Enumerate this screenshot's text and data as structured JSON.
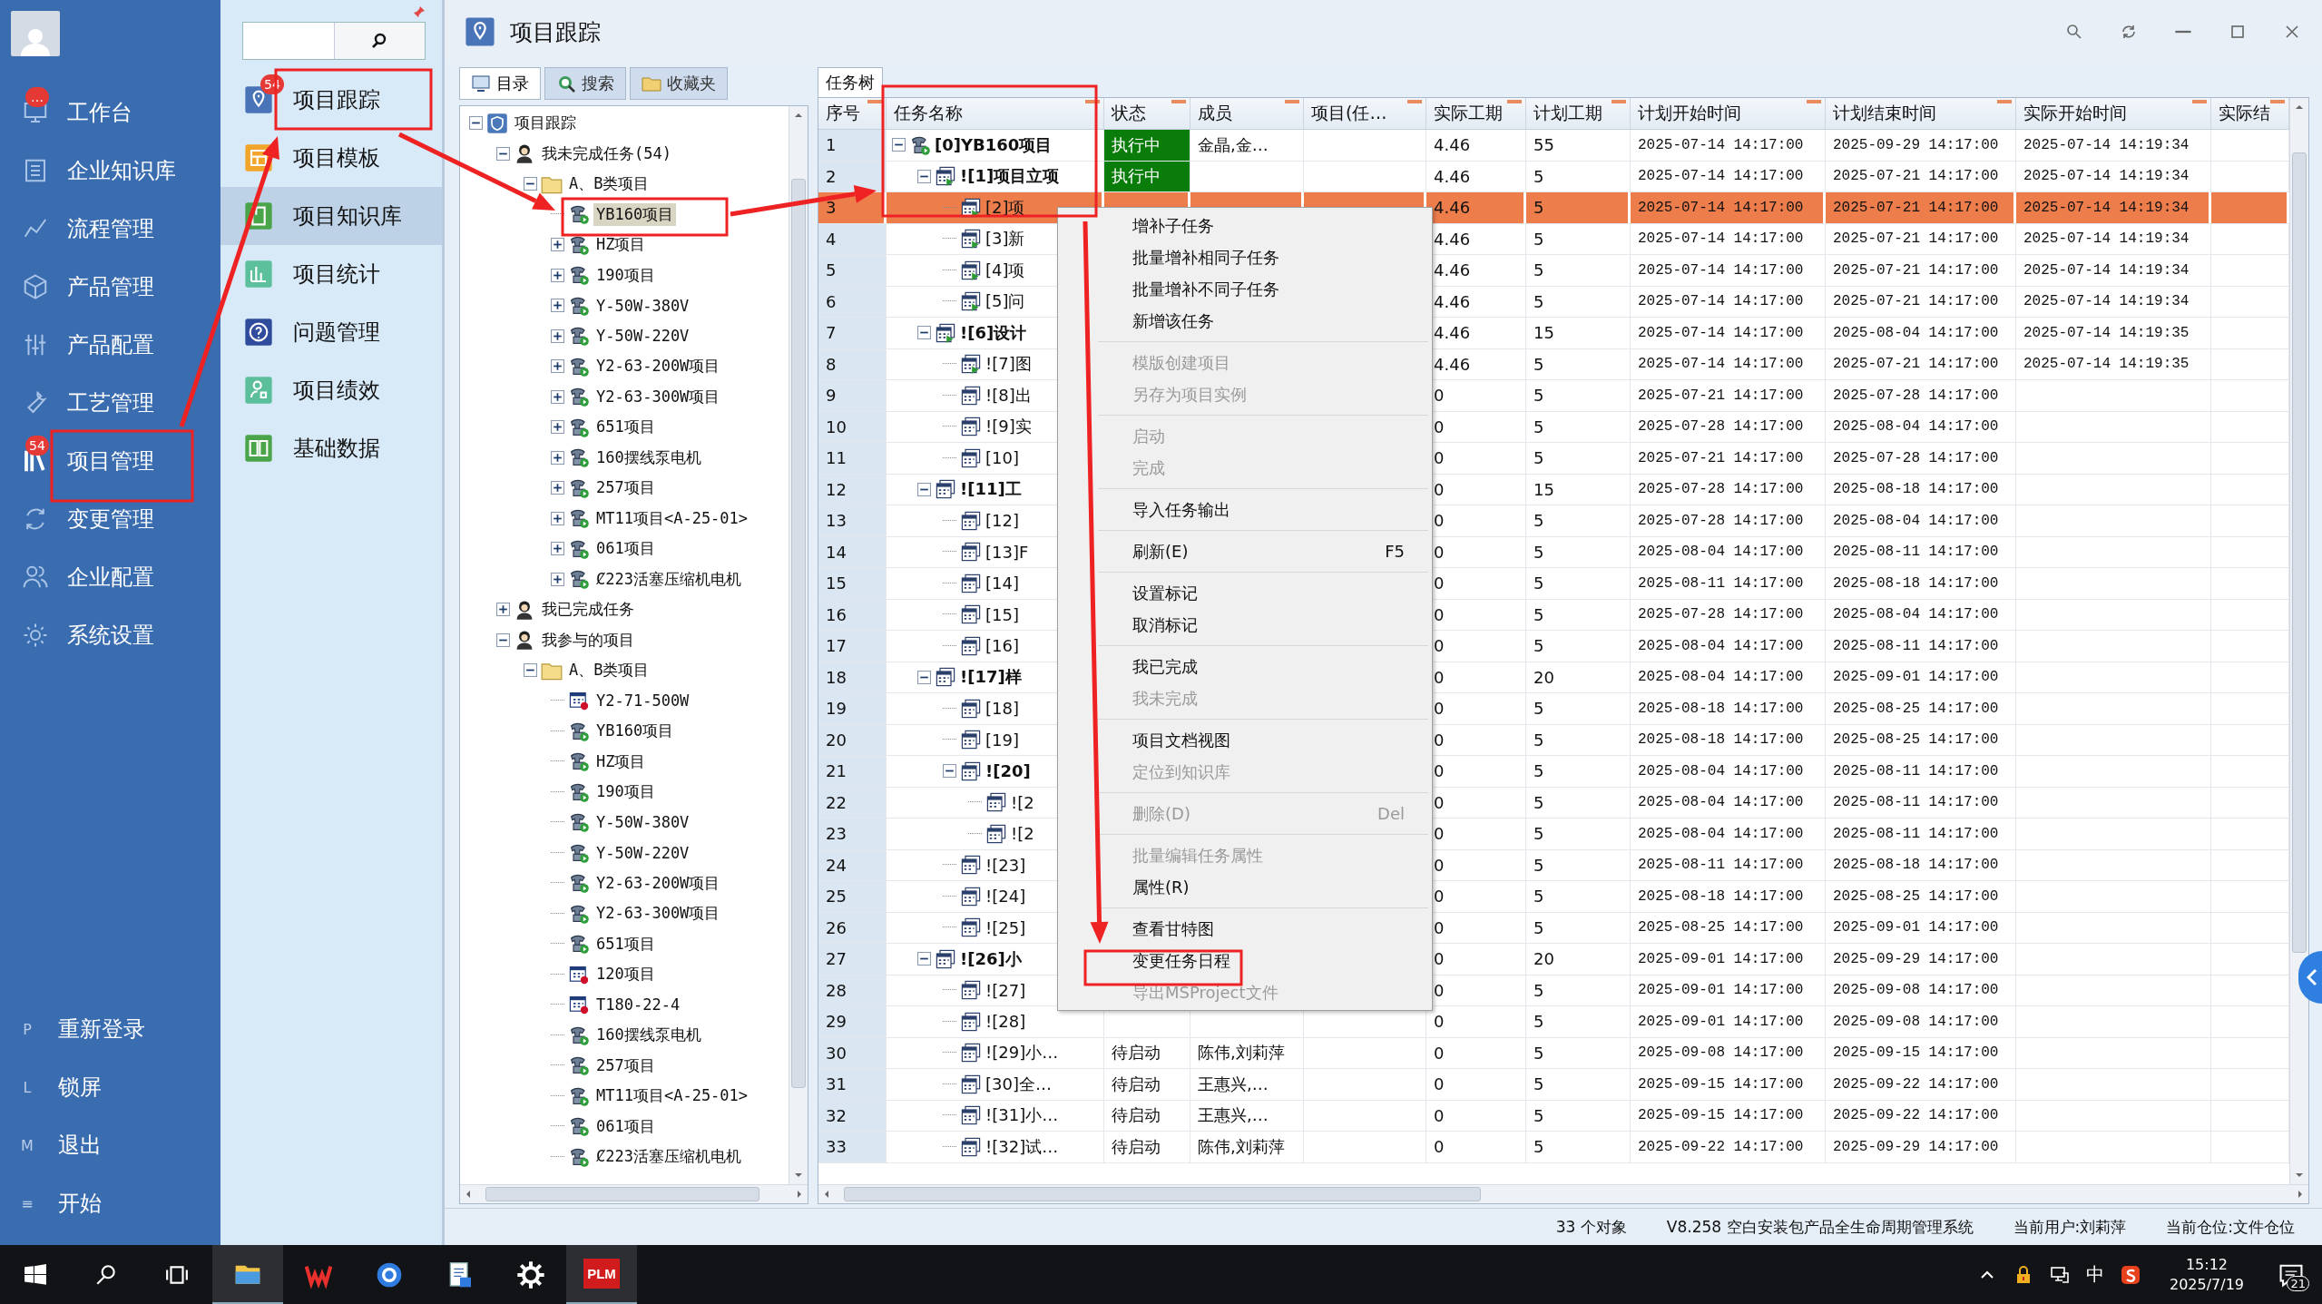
{
  "sidebar": {
    "nav": [
      {
        "label": "工作台",
        "badge": "…"
      },
      {
        "label": "企业知识库"
      },
      {
        "label": "流程管理"
      },
      {
        "label": "产品管理"
      },
      {
        "label": "产品配置"
      },
      {
        "label": "工艺管理"
      },
      {
        "label": "项目管理",
        "badge": "54"
      },
      {
        "label": "变更管理"
      },
      {
        "label": "企业配置"
      },
      {
        "label": "系统设置"
      }
    ],
    "bottom": [
      {
        "key": "P",
        "label": "重新登录"
      },
      {
        "key": "L",
        "label": "锁屏"
      },
      {
        "key": "M",
        "label": "退出"
      },
      {
        "key": "≡",
        "label": "开始"
      }
    ]
  },
  "subnav": {
    "items": [
      {
        "label": "项目跟踪",
        "badge": "54",
        "selected": false
      },
      {
        "label": "项目模板",
        "selected": false
      },
      {
        "label": "项目知识库",
        "selected": true
      },
      {
        "label": "项目统计",
        "selected": false
      },
      {
        "label": "问题管理",
        "selected": false
      },
      {
        "label": "项目绩效",
        "selected": false
      },
      {
        "label": "基础数据",
        "selected": false
      }
    ]
  },
  "window": {
    "title": "项目跟踪"
  },
  "pane_tabs": [
    {
      "label": "目录",
      "selected": true
    },
    {
      "label": "搜索",
      "selected": false
    },
    {
      "label": "收藏夹",
      "selected": false
    }
  ],
  "tree": [
    {
      "label": "项目跟踪",
      "kind": "root",
      "expanded": true,
      "selected": false,
      "children": [
        {
          "label": "我未完成任务(54)",
          "kind": "user",
          "expanded": true,
          "selected": false,
          "children": [
            {
              "label": "A、B类项目",
              "kind": "folder",
              "expanded": true,
              "selected": false,
              "children": [
                {
                  "label": "YB160项目",
                  "kind": "project",
                  "selected": true
                },
                {
                  "label": "HZ项目",
                  "kind": "project",
                  "expanded": false,
                  "selected": false
                },
                {
                  "label": "190项目",
                  "kind": "project",
                  "expanded": false,
                  "selected": false
                },
                {
                  "label": "Y-50W-380V",
                  "kind": "project",
                  "expanded": false,
                  "selected": false
                },
                {
                  "label": "Y-50W-220V",
                  "kind": "project",
                  "expanded": false,
                  "selected": false
                },
                {
                  "label": "Y2-63-200W项目",
                  "kind": "project",
                  "expanded": false,
                  "selected": false
                },
                {
                  "label": "Y2-63-300W项目",
                  "kind": "project",
                  "expanded": false,
                  "selected": false
                },
                {
                  "label": "651项目",
                  "kind": "project",
                  "expanded": false,
                  "selected": false
                },
                {
                  "label": "160摆线泵电机",
                  "kind": "project",
                  "expanded": false,
                  "selected": false
                },
                {
                  "label": "257项目",
                  "kind": "project",
                  "expanded": false,
                  "selected": false
                },
                {
                  "label": "MT11项目<A-25-01>",
                  "kind": "project",
                  "expanded": false,
                  "selected": false
                },
                {
                  "label": "061项目",
                  "kind": "project",
                  "expanded": false,
                  "selected": false
                },
                {
                  "label": "Ȼ223活塞压缩机电机",
                  "kind": "project",
                  "expanded": false,
                  "selected": false
                }
              ]
            }
          ]
        },
        {
          "label": "我已完成任务",
          "kind": "user",
          "expanded": false,
          "selected": false
        },
        {
          "label": "我参与的项目",
          "kind": "user",
          "expanded": true,
          "selected": false,
          "children": [
            {
              "label": "A、B类项目",
              "kind": "folder",
              "expanded": true,
              "selected": false,
              "children": [
                {
                  "label": "Y2-71-500W",
                  "kind": "plan",
                  "selected": false
                },
                {
                  "label": "YB160项目",
                  "kind": "project",
                  "selected": false
                },
                {
                  "label": "HZ项目",
                  "kind": "project",
                  "selected": false
                },
                {
                  "label": "190项目",
                  "kind": "project",
                  "selected": false
                },
                {
                  "label": "Y-50W-380V",
                  "kind": "project",
                  "selected": false
                },
                {
                  "label": "Y-50W-220V",
                  "kind": "project",
                  "selected": false
                },
                {
                  "label": "Y2-63-200W项目",
                  "kind": "project",
                  "selected": false
                },
                {
                  "label": "Y2-63-300W项目",
                  "kind": "project",
                  "selected": false
                },
                {
                  "label": "651项目",
                  "kind": "project",
                  "selected": false
                },
                {
                  "label": "120项目",
                  "kind": "plan",
                  "selected": false
                },
                {
                  "label": "T180-22-4",
                  "kind": "plan",
                  "selected": false
                },
                {
                  "label": "160摆线泵电机",
                  "kind": "project",
                  "selected": false
                },
                {
                  "label": "257项目",
                  "kind": "project",
                  "selected": false
                },
                {
                  "label": "MT11项目<A-25-01>",
                  "kind": "project",
                  "selected": false
                },
                {
                  "label": "061项目",
                  "kind": "project",
                  "selected": false
                },
                {
                  "label": "Ȼ223活塞压缩机电机",
                  "kind": "project",
                  "selected": false
                }
              ]
            }
          ]
        }
      ]
    }
  ],
  "grid": {
    "tab": "任务树",
    "columns": [
      "序号",
      "任务名称",
      "状态",
      "成员",
      "项目(任…",
      "实际工期",
      "计划工期",
      "计划开始时间",
      "计划结束时间",
      "实际开始时间",
      "实际结"
    ],
    "rows": [
      {
        "seq": "1",
        "name": "[0]YB160项目",
        "status": "执行中",
        "color": "#0a7c0a",
        "members": "金晶,金…",
        "actual_days": "4.46",
        "plan_days": "55",
        "plan_start": "2025-07-14 14:17:00",
        "plan_end": "2025-09-29 14:17:00",
        "actual_start": "2025-07-14 14:19:34",
        "started": true,
        "expanded": true,
        "selected": false,
        "children": [
          {
            "seq": "2",
            "name": "![1]项目立项",
            "status": "执行中",
            "color": "#0a7c0a",
            "actual_days": "4.46",
            "plan_days": "5",
            "plan_start": "2025-07-14 14:17:00",
            "plan_end": "2025-07-21 14:17:00",
            "actual_start": "2025-07-14 14:19:34",
            "started": true,
            "expanded": true,
            "selected": false,
            "children": [
              {
                "seq": "3",
                "name": "[2]项",
                "actual_days": "4.46",
                "plan_days": "5",
                "plan_start": "2025-07-14 14:17:00",
                "plan_end": "2025-07-21 14:17:00",
                "actual_start": "2025-07-14 14:19:34",
                "started": true,
                "selected": true
              },
              {
                "seq": "4",
                "name": "[3]新",
                "actual_days": "4.46",
                "plan_days": "5",
                "plan_start": "2025-07-14 14:17:00",
                "plan_end": "2025-07-21 14:17:00",
                "actual_start": "2025-07-14 14:19:34",
                "started": true,
                "selected": false
              },
              {
                "seq": "5",
                "name": "[4]项",
                "actual_days": "4.46",
                "plan_days": "5",
                "plan_start": "2025-07-14 14:17:00",
                "plan_end": "2025-07-21 14:17:00",
                "actual_start": "2025-07-14 14:19:34",
                "started": true,
                "selected": false
              },
              {
                "seq": "6",
                "name": "[5]问",
                "actual_days": "4.46",
                "plan_days": "5",
                "plan_start": "2025-07-14 14:17:00",
                "plan_end": "2025-07-21 14:17:00",
                "actual_start": "2025-07-14 14:19:34",
                "started": true,
                "selected": false
              }
            ]
          },
          {
            "seq": "7",
            "name": "![6]设计",
            "actual_days": "4.46",
            "plan_days": "15",
            "plan_start": "2025-07-14 14:17:00",
            "plan_end": "2025-08-04 14:17:00",
            "actual_start": "2025-07-14 14:19:35",
            "started": true,
            "expanded": true,
            "selected": false,
            "children": [
              {
                "seq": "8",
                "name": "![7]图",
                "actual_days": "4.46",
                "plan_days": "5",
                "plan_start": "2025-07-14 14:17:00",
                "plan_end": "2025-07-21 14:17:00",
                "actual_start": "2025-07-14 14:19:35",
                "started": true,
                "selected": false
              },
              {
                "seq": "9",
                "name": "![8]出",
                "actual_days": "0",
                "plan_days": "5",
                "plan_start": "2025-07-21 14:17:00",
                "plan_end": "2025-07-28 14:17:00",
                "started": false,
                "selected": false
              },
              {
                "seq": "10",
                "name": "![9]实",
                "actual_days": "0",
                "plan_days": "5",
                "plan_start": "2025-07-28 14:17:00",
                "plan_end": "2025-08-04 14:17:00",
                "started": false,
                "selected": false
              },
              {
                "seq": "11",
                "name": "[10]",
                "actual_days": "0",
                "plan_days": "5",
                "plan_start": "2025-07-21 14:17:00",
                "plan_end": "2025-07-28 14:17:00",
                "started": false,
                "selected": false
              }
            ]
          },
          {
            "seq": "12",
            "name": "![11]工",
            "actual_days": "0",
            "plan_days": "15",
            "plan_start": "2025-07-28 14:17:00",
            "plan_end": "2025-08-18 14:17:00",
            "started": false,
            "expanded": true,
            "selected": false,
            "children": [
              {
                "seq": "13",
                "name": "[12]",
                "actual_days": "0",
                "plan_days": "5",
                "plan_start": "2025-07-28 14:17:00",
                "plan_end": "2025-08-04 14:17:00",
                "started": false,
                "selected": false
              },
              {
                "seq": "14",
                "name": "[13]F",
                "actual_days": "0",
                "plan_days": "5",
                "plan_start": "2025-08-04 14:17:00",
                "plan_end": "2025-08-11 14:17:00",
                "started": false,
                "selected": false
              },
              {
                "seq": "15",
                "name": "[14]",
                "actual_days": "0",
                "plan_days": "5",
                "plan_start": "2025-08-11 14:17:00",
                "plan_end": "2025-08-18 14:17:00",
                "started": false,
                "selected": false
              },
              {
                "seq": "16",
                "name": "[15]",
                "actual_days": "0",
                "plan_days": "5",
                "plan_start": "2025-07-28 14:17:00",
                "plan_end": "2025-08-04 14:17:00",
                "started": false,
                "selected": false
              },
              {
                "seq": "17",
                "name": "[16]",
                "actual_days": "0",
                "plan_days": "5",
                "plan_start": "2025-08-04 14:17:00",
                "plan_end": "2025-08-11 14:17:00",
                "started": false,
                "selected": false
              }
            ]
          },
          {
            "seq": "18",
            "name": "![17]样",
            "actual_days": "0",
            "plan_days": "20",
            "plan_start": "2025-08-04 14:17:00",
            "plan_end": "2025-09-01 14:17:00",
            "started": false,
            "expanded": true,
            "selected": false,
            "children": [
              {
                "seq": "19",
                "name": "[18]",
                "actual_days": "0",
                "plan_days": "5",
                "plan_start": "2025-08-18 14:17:00",
                "plan_end": "2025-08-25 14:17:00",
                "started": false,
                "selected": false
              },
              {
                "seq": "20",
                "name": "[19]",
                "actual_days": "0",
                "plan_days": "5",
                "plan_start": "2025-08-18 14:17:00",
                "plan_end": "2025-08-25 14:17:00",
                "started": false,
                "selected": false
              },
              {
                "seq": "21",
                "name": "![20]",
                "actual_days": "0",
                "plan_days": "5",
                "plan_start": "2025-08-04 14:17:00",
                "plan_end": "2025-08-11 14:17:00",
                "started": false,
                "expanded": true,
                "selected": false,
                "children": [
                  {
                    "seq": "22",
                    "name": "![2",
                    "actual_days": "0",
                    "plan_days": "5",
                    "plan_start": "2025-08-04 14:17:00",
                    "plan_end": "2025-08-11 14:17:00",
                    "started": false,
                    "selected": false
                  },
                  {
                    "seq": "23",
                    "name": "![2",
                    "actual_days": "0",
                    "plan_days": "5",
                    "plan_start": "2025-08-04 14:17:00",
                    "plan_end": "2025-08-11 14:17:00",
                    "started": false,
                    "selected": false
                  }
                ]
              },
              {
                "seq": "24",
                "name": "![23]",
                "actual_days": "0",
                "plan_days": "5",
                "plan_start": "2025-08-11 14:17:00",
                "plan_end": "2025-08-18 14:17:00",
                "started": false,
                "selected": false
              },
              {
                "seq": "25",
                "name": "![24]",
                "actual_days": "0",
                "plan_days": "5",
                "plan_start": "2025-08-18 14:17:00",
                "plan_end": "2025-08-25 14:17:00",
                "started": false,
                "selected": false
              },
              {
                "seq": "26",
                "name": "![25]",
                "actual_days": "0",
                "plan_days": "5",
                "plan_start": "2025-08-25 14:17:00",
                "plan_end": "2025-09-01 14:17:00",
                "started": false,
                "selected": false
              }
            ]
          },
          {
            "seq": "27",
            "name": "![26]小",
            "actual_days": "0",
            "plan_days": "20",
            "plan_start": "2025-09-01 14:17:00",
            "plan_end": "2025-09-29 14:17:00",
            "started": false,
            "expanded": true,
            "selected": false,
            "children": [
              {
                "seq": "28",
                "name": "![27]",
                "actual_days": "0",
                "plan_days": "5",
                "plan_start": "2025-09-01 14:17:00",
                "plan_end": "2025-09-08 14:17:00",
                "started": false,
                "selected": false
              },
              {
                "seq": "29",
                "name": "![28]",
                "actual_days": "0",
                "plan_days": "5",
                "plan_start": "2025-09-01 14:17:00",
                "plan_end": "2025-09-08 14:17:00",
                "started": false,
                "selected": false
              },
              {
                "seq": "30",
                "name": "![29]小…",
                "status": "待启动",
                "members": "陈伟,刘莉萍",
                "actual_days": "0",
                "plan_days": "5",
                "plan_start": "2025-09-08 14:17:00",
                "plan_end": "2025-09-15 14:17:00",
                "started": false,
                "selected": false
              },
              {
                "seq": "31",
                "name": "[30]全…",
                "status": "待启动",
                "members": "王惠兴,…",
                "actual_days": "0",
                "plan_days": "5",
                "plan_start": "2025-09-15 14:17:00",
                "plan_end": "2025-09-22 14:17:00",
                "started": false,
                "selected": false
              },
              {
                "seq": "32",
                "name": "![31]小…",
                "status": "待启动",
                "members": "王惠兴,…",
                "actual_days": "0",
                "plan_days": "5",
                "plan_start": "2025-09-15 14:17:00",
                "plan_end": "2025-09-22 14:17:00",
                "started": false,
                "selected": false
              },
              {
                "seq": "33",
                "name": "![32]试…",
                "status": "待启动",
                "members": "陈伟,刘莉萍",
                "actual_days": "0",
                "plan_days": "5",
                "plan_start": "2025-09-22 14:17:00",
                "plan_end": "2025-09-29 14:17:00",
                "started": false,
                "selected": false
              }
            ]
          }
        ]
      }
    ]
  },
  "context_menu": {
    "groups": [
      [
        {
          "label": "增补子任务",
          "disabled": false
        },
        {
          "label": "批量增补相同子任务",
          "disabled": false
        },
        {
          "label": "批量增补不同子任务",
          "disabled": false
        },
        {
          "label": "新增该任务",
          "disabled": false
        }
      ],
      [
        {
          "label": "模版创建项目",
          "disabled": true
        },
        {
          "label": "另存为项目实例",
          "disabled": true
        }
      ],
      [
        {
          "label": "启动",
          "disabled": true
        },
        {
          "label": "完成",
          "disabled": true
        }
      ],
      [
        {
          "label": "导入任务输出",
          "disabled": false
        }
      ],
      [
        {
          "label": "刷新(E)",
          "shortcut": "F5",
          "disabled": false
        }
      ],
      [
        {
          "label": "设置标记",
          "disabled": false
        },
        {
          "label": "取消标记",
          "disabled": false
        }
      ],
      [
        {
          "label": "我已完成",
          "disabled": false
        },
        {
          "label": "我未完成",
          "disabled": true
        }
      ],
      [
        {
          "label": "项目文档视图",
          "disabled": false
        },
        {
          "label": "定位到知识库",
          "disabled": true
        }
      ],
      [
        {
          "label": "删除(D)",
          "shortcut": "Del",
          "disabled": true
        }
      ],
      [
        {
          "label": "批量编辑任务属性",
          "disabled": true
        },
        {
          "label": "属性(R)",
          "disabled": false
        }
      ],
      [
        {
          "label": "查看甘特图",
          "disabled": false
        },
        {
          "label": "变更任务日程",
          "disabled": false
        },
        {
          "label": "导出MSProject文件",
          "disabled": true
        }
      ]
    ]
  },
  "status_bar": {
    "count": "33 个对象",
    "system": "V8.258 空白安装包产品全生命周期管理系统",
    "user": "当前用户:刘莉萍",
    "location": "当前仓位:文件仓位"
  },
  "taskbar": {
    "apps": [
      {
        "kind": "explorer",
        "selected": true
      },
      {
        "kind": "wps",
        "selected": false
      },
      {
        "kind": "browser",
        "selected": false
      },
      {
        "kind": "document",
        "selected": false
      },
      {
        "kind": "settings",
        "selected": false
      },
      {
        "kind": "plm",
        "label": "PLM",
        "selected": true
      }
    ],
    "ime": "中",
    "time": "15:12",
    "date": "2025/7/19",
    "notifications": "21"
  }
}
